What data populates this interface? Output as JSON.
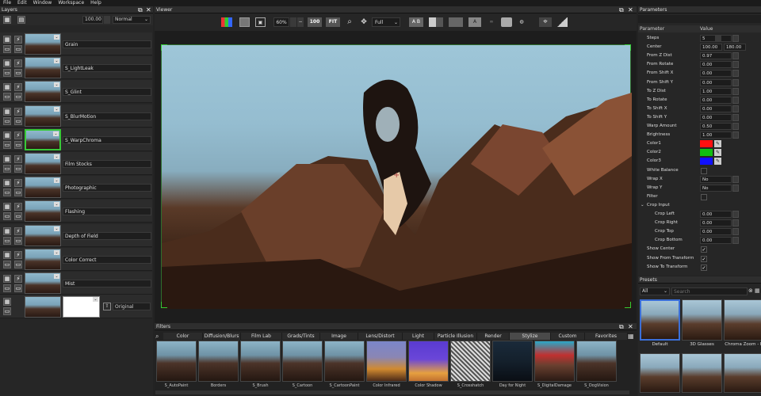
{
  "menu": [
    "File",
    "Edit",
    "Window",
    "Workspace",
    "Help"
  ],
  "layers_panel": {
    "title": "Layers",
    "opacity": "100.00",
    "blend_mode": "Normal",
    "layers": [
      {
        "name": "Grain"
      },
      {
        "name": "S_LightLeak"
      },
      {
        "name": "S_Glint"
      },
      {
        "name": "S_BlurMotion"
      },
      {
        "name": "S_WarpChroma"
      },
      {
        "name": "Film Stocks"
      },
      {
        "name": "Photographic"
      },
      {
        "name": "Flashing"
      },
      {
        "name": "Depth of Field"
      },
      {
        "name": "Color Correct"
      },
      {
        "name": "Mist"
      }
    ],
    "original_label": "Original"
  },
  "viewer": {
    "title": "Viewer",
    "zoom": "60%",
    "btn_100": "100",
    "btn_fit": "FIT",
    "channel": "Full",
    "btn_ab": "A B"
  },
  "parameters": {
    "title": "Parameters",
    "col_param": "Parameter",
    "col_value": "Value",
    "rows": [
      {
        "label": "Steps",
        "value": "5"
      },
      {
        "label": "Center",
        "value": "100.00",
        "value2": "180.00"
      },
      {
        "label": "From Z Dist",
        "value": "0.97"
      },
      {
        "label": "From Rotate",
        "value": "0.00"
      },
      {
        "label": "From Shift X",
        "value": "0.00"
      },
      {
        "label": "From Shift Y",
        "value": "0.00"
      },
      {
        "label": "To Z Dist",
        "value": "1.00"
      },
      {
        "label": "To Rotate",
        "value": "0.00"
      },
      {
        "label": "To Shift X",
        "value": "0.00"
      },
      {
        "label": "To Shift Y",
        "value": "0.00"
      },
      {
        "label": "Warp Amount",
        "value": "0.50"
      },
      {
        "label": "Brightness",
        "value": "1.00"
      },
      {
        "label": "Color1",
        "color": "#ff1010"
      },
      {
        "label": "Color2",
        "color": "#10c010"
      },
      {
        "label": "Color3",
        "color": "#1010ff"
      },
      {
        "label": "White Balance"
      },
      {
        "label": "Wrap X",
        "value": "No"
      },
      {
        "label": "Wrap Y",
        "value": "No"
      },
      {
        "label": "Filter"
      },
      {
        "label": "Crop Input"
      },
      {
        "label": "Crop Left",
        "value": "0.00"
      },
      {
        "label": "Crop Right",
        "value": "0.00"
      },
      {
        "label": "Crop Top",
        "value": "0.00"
      },
      {
        "label": "Crop Bottom",
        "value": "0.00"
      },
      {
        "label": "Show Center",
        "check": "✓"
      },
      {
        "label": "Show From Transform",
        "check": "✓"
      },
      {
        "label": "Show To Transform",
        "check": "✓"
      }
    ]
  },
  "presets": {
    "title": "Presets",
    "filter": "All",
    "search_placeholder": "Search",
    "items": [
      "Default",
      "3D Glasses",
      "Chroma Zoom - B"
    ]
  },
  "filters": {
    "title": "Filters",
    "tabs": [
      "Color",
      "Diffusion/Blurs",
      "Film Lab",
      "Grads/Tints",
      "Image",
      "Lens/Distort",
      "Light",
      "Particle Illusion",
      "Render",
      "Stylize",
      "Custom",
      "Favorites"
    ],
    "active_tab": "Stylize",
    "items": [
      "S_AutoPaint",
      "Borders",
      "S_Brush",
      "S_Cartoon",
      "S_CartoonPaint",
      "Color Infrared",
      "Color Shadow",
      "S_Crosshatch",
      "Day for Night",
      "S_DigitalDamage",
      "S_DogVision"
    ]
  }
}
